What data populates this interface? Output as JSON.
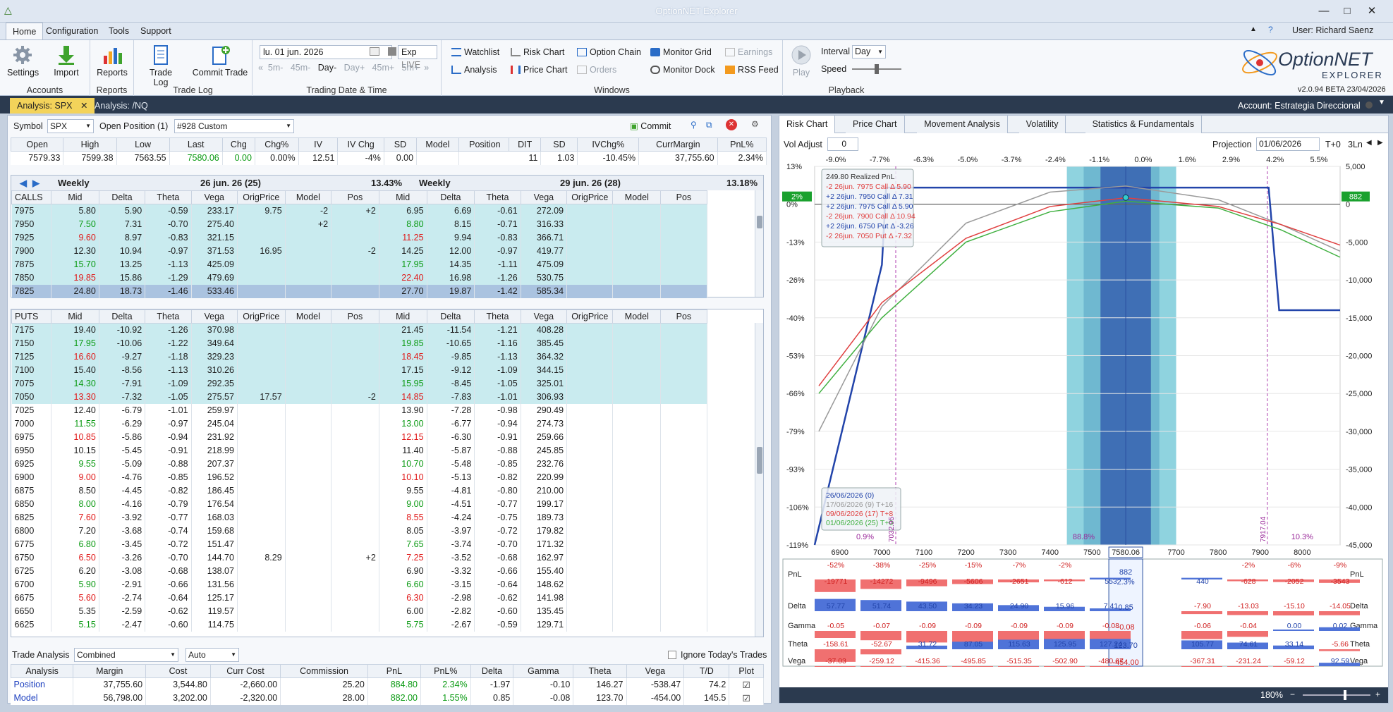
{
  "window": {
    "title": "OptionNET Explorer",
    "user": "User: Richard Saenz"
  },
  "menu": [
    "Home",
    "Configuration",
    "Tools",
    "Support"
  ],
  "ribbon": {
    "accounts": {
      "settings": "Settings",
      "import": "Import",
      "label": "Accounts"
    },
    "reports": {
      "reports": "Reports",
      "label": "Reports"
    },
    "tradelog": {
      "tradelog": "Trade Log",
      "commit": "Commit Trade",
      "label": "Trade Log"
    },
    "trading": {
      "date": "lu. 01 jun. 2026",
      "exp": "Exp",
      "live": "LIVE",
      "steps": [
        "5m-",
        "45m-",
        "Day-",
        "Day+",
        "45m+",
        "5m+"
      ],
      "label": "Trading Date & Time"
    },
    "windows": {
      "items": [
        "Watchlist",
        "Risk Chart",
        "Option Chain",
        "Monitor Grid",
        "Earnings",
        "Analysis",
        "Price Chart",
        "Orders",
        "Monitor Dock",
        "RSS Feed"
      ],
      "label": "Windows"
    },
    "playback": {
      "play": "Play",
      "interval_label": "Interval",
      "interval": "Day",
      "speed": "Speed",
      "label": "Playback"
    },
    "brand": {
      "name": "OptionNET",
      "sub": "EXPLORER",
      "version": "v2.0.94 BETA 23/04/2026"
    }
  },
  "doctabs": [
    "Analysis: SPX",
    "Analysis: /NQ"
  ],
  "account": "Account: Estrategia Direccional",
  "symbol": {
    "label": "Symbol",
    "value": "SPX",
    "open_label": "Open Position (1)",
    "position": "#928 Custom",
    "commit": "Commit"
  },
  "quote": {
    "headers": [
      "Open",
      "High",
      "Low",
      "Last",
      "Chg",
      "Chg%",
      "IV",
      "IV Chg",
      "SD",
      "Model",
      "Position"
    ],
    "values": [
      "7579.33",
      "7599.38",
      "7563.55",
      "7580.06",
      "0.00",
      "0.00%",
      "12.51",
      "-4%",
      "0.00",
      "",
      ""
    ]
  },
  "stats": {
    "headers": [
      "DIT",
      "SD",
      "IVChg%",
      "CurrMargin",
      "PnL%"
    ],
    "values": [
      "11",
      "1.03",
      "-10.45%",
      "37,755.60",
      "2.34%"
    ]
  },
  "expiries": [
    {
      "name": "Weekly",
      "date": "26 jun. 26 (25)",
      "iv": "13.43%"
    },
    {
      "name": "Weekly",
      "date": "29 jun. 26 (28)",
      "iv": "13.18%"
    }
  ],
  "chain_cols": [
    "Mid",
    "Delta",
    "Theta",
    "Vega",
    "OrigPrice",
    "Model",
    "Pos"
  ],
  "calls_label": "CALLS",
  "puts_label": "PUTS",
  "calls": [
    [
      "7975",
      "5.80",
      "5.90",
      "-0.59",
      "233.17",
      "9.75",
      "-2",
      "+2",
      "6.95",
      "6.69",
      "-0.61",
      "272.09"
    ],
    [
      "7950",
      "7.50",
      "7.31",
      "-0.70",
      "275.40",
      "",
      "+2",
      "",
      "8.80",
      "8.15",
      "-0.71",
      "316.33"
    ],
    [
      "7925",
      "9.60",
      "8.97",
      "-0.83",
      "321.15",
      "",
      "",
      "",
      "11.25",
      "9.94",
      "-0.83",
      "366.71"
    ],
    [
      "7900",
      "12.30",
      "10.94",
      "-0.97",
      "371.53",
      "16.95",
      "",
      "-2",
      "14.25",
      "12.00",
      "-0.97",
      "419.77"
    ],
    [
      "7875",
      "15.70",
      "13.25",
      "-1.13",
      "425.09",
      "",
      "",
      "",
      "17.95",
      "14.35",
      "-1.11",
      "475.09"
    ],
    [
      "7850",
      "19.85",
      "15.86",
      "-1.29",
      "479.69",
      "",
      "",
      "",
      "22.40",
      "16.98",
      "-1.26",
      "530.75"
    ],
    [
      "7825",
      "24.80",
      "18.73",
      "-1.46",
      "533.46",
      "",
      "",
      "",
      "27.70",
      "19.87",
      "-1.42",
      "585.34"
    ]
  ],
  "puts": [
    [
      "7175",
      "19.40",
      "-10.92",
      "-1.26",
      "370.98",
      "",
      "",
      "",
      "21.45",
      "-11.54",
      "-1.21",
      "408.28"
    ],
    [
      "7150",
      "17.95",
      "-10.06",
      "-1.22",
      "349.64",
      "",
      "",
      "",
      "19.85",
      "-10.65",
      "-1.16",
      "385.45"
    ],
    [
      "7125",
      "16.60",
      "-9.27",
      "-1.18",
      "329.23",
      "",
      "",
      "",
      "18.45",
      "-9.85",
      "-1.13",
      "364.32"
    ],
    [
      "7100",
      "15.40",
      "-8.56",
      "-1.13",
      "310.26",
      "",
      "",
      "",
      "17.15",
      "-9.12",
      "-1.09",
      "344.15"
    ],
    [
      "7075",
      "14.30",
      "-7.91",
      "-1.09",
      "292.35",
      "",
      "",
      "",
      "15.95",
      "-8.45",
      "-1.05",
      "325.01"
    ],
    [
      "7050",
      "13.30",
      "-7.32",
      "-1.05",
      "275.57",
      "17.57",
      "",
      "-2",
      "14.85",
      "-7.83",
      "-1.01",
      "306.93"
    ],
    [
      "7025",
      "12.40",
      "-6.79",
      "-1.01",
      "259.97",
      "",
      "",
      "",
      "13.90",
      "-7.28",
      "-0.98",
      "290.49"
    ],
    [
      "7000",
      "11.55",
      "-6.29",
      "-0.97",
      "245.04",
      "",
      "",
      "",
      "13.00",
      "-6.77",
      "-0.94",
      "274.73"
    ],
    [
      "6975",
      "10.85",
      "-5.86",
      "-0.94",
      "231.92",
      "",
      "",
      "",
      "12.15",
      "-6.30",
      "-0.91",
      "259.66"
    ],
    [
      "6950",
      "10.15",
      "-5.45",
      "-0.91",
      "218.99",
      "",
      "",
      "",
      "11.40",
      "-5.87",
      "-0.88",
      "245.85"
    ],
    [
      "6925",
      "9.55",
      "-5.09",
      "-0.88",
      "207.37",
      "",
      "",
      "",
      "10.70",
      "-5.48",
      "-0.85",
      "232.76"
    ],
    [
      "6900",
      "9.00",
      "-4.76",
      "-0.85",
      "196.52",
      "",
      "",
      "",
      "10.10",
      "-5.13",
      "-0.82",
      "220.99"
    ],
    [
      "6875",
      "8.50",
      "-4.45",
      "-0.82",
      "186.45",
      "",
      "",
      "",
      "9.55",
      "-4.81",
      "-0.80",
      "210.00"
    ],
    [
      "6850",
      "8.00",
      "-4.16",
      "-0.79",
      "176.54",
      "",
      "",
      "",
      "9.00",
      "-4.51",
      "-0.77",
      "199.17"
    ],
    [
      "6825",
      "7.60",
      "-3.92",
      "-0.77",
      "168.03",
      "",
      "",
      "",
      "8.55",
      "-4.24",
      "-0.75",
      "189.73"
    ],
    [
      "6800",
      "7.20",
      "-3.68",
      "-0.74",
      "159.68",
      "",
      "",
      "",
      "8.05",
      "-3.97",
      "-0.72",
      "179.82"
    ],
    [
      "6775",
      "6.80",
      "-3.45",
      "-0.72",
      "151.47",
      "",
      "",
      "",
      "7.65",
      "-3.74",
      "-0.70",
      "171.32"
    ],
    [
      "6750",
      "6.50",
      "-3.26",
      "-0.70",
      "144.70",
      "8.29",
      "",
      "+2",
      "7.25",
      "-3.52",
      "-0.68",
      "162.97"
    ],
    [
      "6725",
      "6.20",
      "-3.08",
      "-0.68",
      "138.07",
      "",
      "",
      "",
      "6.90",
      "-3.32",
      "-0.66",
      "155.40"
    ],
    [
      "6700",
      "5.90",
      "-2.91",
      "-0.66",
      "131.56",
      "",
      "",
      "",
      "6.60",
      "-3.15",
      "-0.64",
      "148.62"
    ],
    [
      "6675",
      "5.60",
      "-2.74",
      "-0.64",
      "125.17",
      "",
      "",
      "",
      "6.30",
      "-2.98",
      "-0.62",
      "141.98"
    ],
    [
      "6650",
      "5.35",
      "-2.59",
      "-0.62",
      "119.57",
      "",
      "",
      "",
      "6.00",
      "-2.82",
      "-0.60",
      "135.45"
    ],
    [
      "6625",
      "5.15",
      "-2.47",
      "-0.60",
      "114.75",
      "",
      "",
      "",
      "5.75",
      "-2.67",
      "-0.59",
      "129.71"
    ]
  ],
  "trade_analysis": {
    "label": "Trade Analysis",
    "mode": "Combined",
    "auto": "Auto",
    "ignore": "Ignore Today's Trades",
    "headers": [
      "Analysis",
      "Margin",
      "Cost",
      "Curr Cost",
      "Commission",
      "PnL",
      "PnL%",
      "Delta",
      "Gamma",
      "Theta",
      "Vega",
      "T/D",
      "Plot"
    ],
    "rows": [
      [
        "Position",
        "37,755.60",
        "3,544.80",
        "-2,660.00",
        "25.20",
        "884.80",
        "2.34%",
        "-1.97",
        "-0.10",
        "146.27",
        "-538.47",
        "74.2"
      ],
      [
        "Model",
        "56,798.00",
        "3,202.00",
        "-2,320.00",
        "28.00",
        "882.00",
        "1.55%",
        "0.85",
        "-0.08",
        "123.70",
        "-454.00",
        "145.5"
      ]
    ]
  },
  "right_tabs": [
    "Risk Chart",
    "Price Chart",
    "Movement Analysis",
    "Volatility",
    "Statistics & Fundamentals"
  ],
  "vol_adjust": {
    "label": "Vol Adjust",
    "value": "0",
    "projection": "Projection",
    "date": "01/06/2026",
    "t0": "T+0",
    "ln": "3Ln"
  },
  "risk_chart": {
    "top_pct": [
      "-9.0%",
      "-7.7%",
      "-6.3%",
      "-5.0%",
      "-3.7%",
      "-2.4%",
      "-1.1%",
      "0.0%",
      "1.6%",
      "2.9%",
      "4.2%",
      "5.5%"
    ],
    "left_pct": [
      "13%",
      "0%",
      "-13%",
      "-26%",
      "-40%",
      "-53%",
      "-66%",
      "-79%",
      "-93%",
      "-106%",
      "-119%"
    ],
    "right_pnl": [
      "5,000",
      "0",
      "-5,000",
      "-10,000",
      "-15,000",
      "-20,000",
      "-25,000",
      "-30,000",
      "-35,000",
      "-40,000",
      "-45,000"
    ],
    "x_ticks": [
      "6900",
      "7000",
      "7100",
      "7200",
      "7300",
      "7400",
      "7500",
      "7580.06",
      "7700",
      "7800",
      "7900",
      "8000"
    ],
    "pct_marker": "2%",
    "pnl_marker": "882",
    "legend": [
      "249.80  Realized PnL",
      "-2 26jun. 7975 Call Δ   5.90",
      "+2 26jun. 7950 Call Δ   7.31",
      "+2 26jun. 7975 Call Δ   5.90",
      "-2 26jun. 7900 Call Δ  10.94",
      "+2 26jun. 6750 Put Δ  -3.26",
      "-2 26jun. 7050 Put Δ  -7.32"
    ],
    "dates": [
      "26/06/2026 (0)",
      "17/06/2026 (9) T+16",
      "09/06/2026 (17) T+8",
      "01/06/2026 (25) T+0"
    ],
    "bottom_pct": [
      "0.9%",
      "88.8%",
      "10.3%"
    ],
    "vlabels": [
      "7032.95",
      "7917.04"
    ],
    "series": [
      {
        "name": "26/06/2026 (0)",
        "color": "#2244aa",
        "x": [
          6840,
          7000,
          7010,
          7892,
          7920,
          7945,
          8090
        ],
        "y": [
          -45000,
          -8000,
          2200,
          2200,
          2200,
          -14000,
          -14000
        ]
      },
      {
        "name": "17/06/2026 (9) T+16",
        "color": "#9a9a9a",
        "x": [
          6850,
          7000,
          7200,
          7400,
          7580,
          7800,
          7950,
          8090
        ],
        "y": [
          -30000,
          -13500,
          -2500,
          1600,
          2400,
          600,
          -2700,
          -6200
        ]
      },
      {
        "name": "09/06/2026 (17) T+8",
        "color": "#e04040",
        "x": [
          6850,
          7000,
          7200,
          7400,
          7580,
          7800,
          7950,
          8090
        ],
        "y": [
          -24000,
          -13000,
          -4500,
          -300,
          850,
          -300,
          -2700,
          -5400
        ]
      },
      {
        "name": "01/06/2026 (25) T+0",
        "color": "#40b040",
        "x": [
          6850,
          7000,
          7200,
          7400,
          7580,
          7800,
          7950,
          8090
        ],
        "y": [
          -25000,
          -15000,
          -5000,
          -1000,
          400,
          -500,
          -3400,
          -7000
        ]
      }
    ],
    "xlim": [
      6840,
      8090
    ],
    "ylim": [
      -45000,
      5000
    ]
  },
  "greeks": {
    "labels": [
      "PnL",
      "Delta",
      "Gamma",
      "Theta",
      "Vega"
    ],
    "center": {
      "PnL": "882",
      "PnL%": "2.3%",
      "Delta": "0.85",
      "Gamma": "-0.08",
      "Theta": "123.70",
      "Vega": "-454.00"
    },
    "pnl_top": [
      "-52%",
      "-38%",
      "-25%",
      "-15%",
      "-7%",
      "-2%",
      "",
      "",
      "",
      "-2%",
      "-6%",
      "-9%"
    ],
    "pnl_bot": [
      "-19771",
      "-14272",
      "-9496",
      "-5606",
      "-2651",
      "-612",
      "553",
      "",
      "440",
      "-628",
      "-2052",
      "-3543"
    ],
    "delta": [
      "57.77",
      "51.74",
      "43.50",
      "34.23",
      "24.90",
      "15.96",
      "7.41",
      "",
      "-7.90",
      "-13.03",
      "-15.10",
      "-14.05"
    ],
    "gamma": [
      "-0.05",
      "-0.07",
      "-0.09",
      "-0.09",
      "-0.09",
      "-0.09",
      "-0.08",
      "",
      "-0.06",
      "-0.04",
      "0.00",
      "0.02"
    ],
    "theta": [
      "-158.61",
      "-52.67",
      "31.72",
      "87.05",
      "115.63",
      "125.95",
      "127.24",
      "",
      "105.77",
      "74.61",
      "33.14",
      "-5.66"
    ],
    "vega": [
      "-37.03",
      "-259.12",
      "-415.36",
      "-495.85",
      "-515.35",
      "-502.90",
      "-480.67",
      "",
      "-367.31",
      "-231.24",
      "-59.12",
      "92.59"
    ]
  },
  "zoom": "180%"
}
